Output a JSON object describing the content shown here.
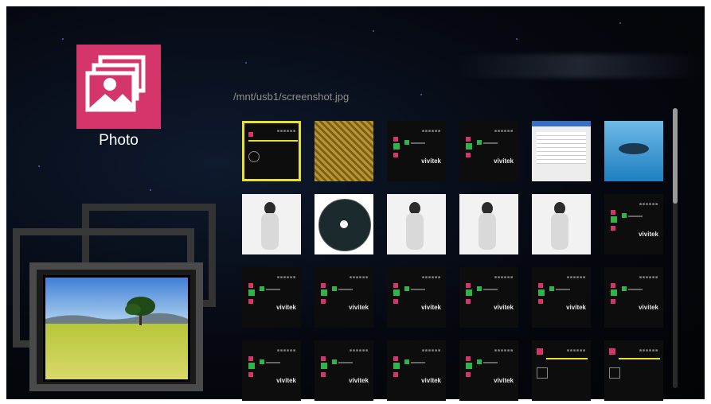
{
  "app": {
    "title": "Photo",
    "icon": "photo-app-icon",
    "accent": "#d4356b"
  },
  "path": "/mnt/usb1/screenshot.jpg",
  "selection_color": "#e8e12b",
  "thumbnails": [
    {
      "kind": "settings-screen",
      "brand": ""
    },
    {
      "kind": "gold-pattern",
      "brand": ""
    },
    {
      "kind": "menu-screen",
      "brand": "vivitek"
    },
    {
      "kind": "menu-screen",
      "brand": "vivitek"
    },
    {
      "kind": "file-dialog",
      "brand": ""
    },
    {
      "kind": "dolphin-photo",
      "brand": ""
    },
    {
      "kind": "portrait",
      "brand": ""
    },
    {
      "kind": "cd-disc",
      "brand": ""
    },
    {
      "kind": "portrait",
      "brand": ""
    },
    {
      "kind": "portrait",
      "brand": ""
    },
    {
      "kind": "portrait",
      "brand": ""
    },
    {
      "kind": "menu-screen",
      "brand": "vivitek"
    },
    {
      "kind": "menu-screen",
      "brand": "vivitek"
    },
    {
      "kind": "menu-screen",
      "brand": "vivitek"
    },
    {
      "kind": "menu-screen",
      "brand": "vivitek"
    },
    {
      "kind": "menu-screen",
      "brand": "vivitek"
    },
    {
      "kind": "menu-screen",
      "brand": "vivitek"
    },
    {
      "kind": "menu-screen",
      "brand": "vivitek"
    },
    {
      "kind": "menu-screen",
      "brand": "vivitek"
    },
    {
      "kind": "menu-screen",
      "brand": "vivitek"
    },
    {
      "kind": "menu-screen",
      "brand": "vivitek"
    },
    {
      "kind": "menu-screen",
      "brand": "vivitek"
    },
    {
      "kind": "file-screen",
      "brand": ""
    },
    {
      "kind": "music-screen",
      "brand": ""
    }
  ]
}
